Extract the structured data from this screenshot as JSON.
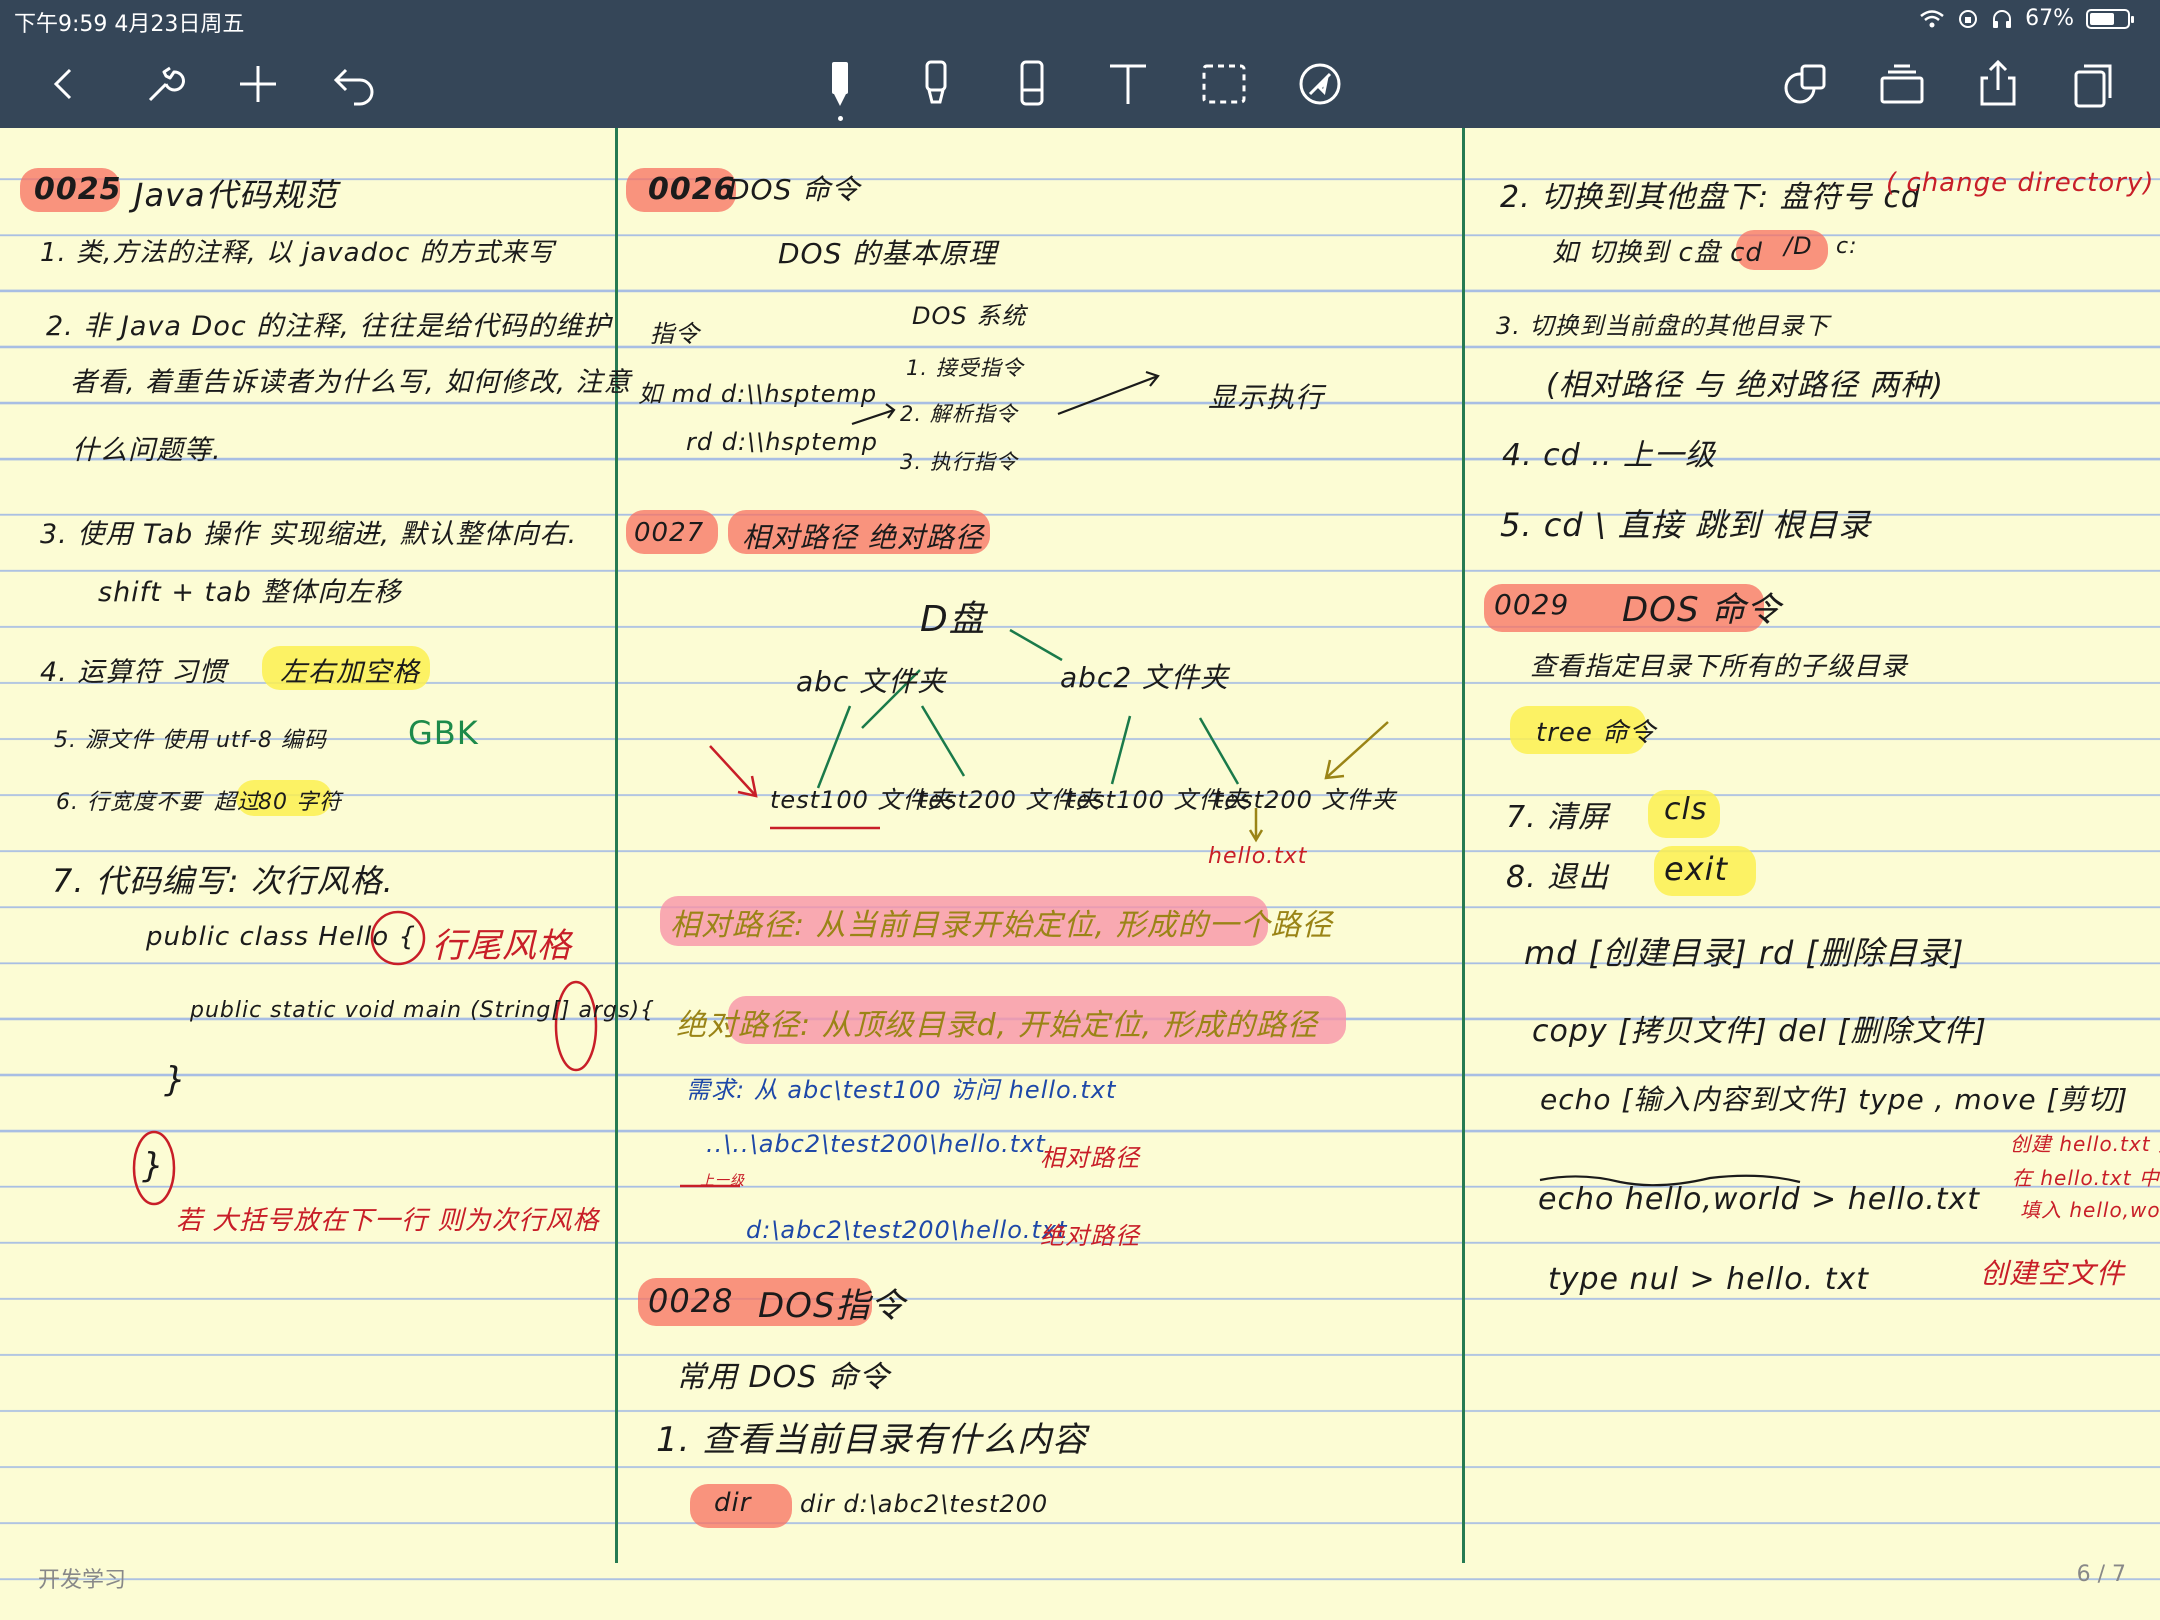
{
  "status": {
    "time": "下午9:59  4月23日周五",
    "battery_text": "67%",
    "battery_level": 0.67
  },
  "toolbar": {
    "left_tools": [
      "back-icon",
      "wrench-icon",
      "plus-icon",
      "undo-icon"
    ],
    "center_tools": [
      "pen-icon",
      "highlighter-icon",
      "eraser-icon",
      "text-icon",
      "lasso-icon",
      "sticker-icon"
    ],
    "right_tools": [
      "copy-page-icon",
      "pages-icon",
      "share-icon",
      "duplicate-icon"
    ],
    "active_tool": "pen-icon"
  },
  "col1": {
    "h0025": "0025",
    "h0025_title": "Java代码规范",
    "l1": "1. 类,方法的注释, 以 javadoc 的方式来写",
    "l2a": "2. 非 Java Doc 的注释, 往往是给代码的维护",
    "l2b": "者看, 着重告诉读者为什么写, 如何修改, 注意",
    "l2c": "什么问题等.",
    "l3a": "3. 使用 Tab 操作 实现缩进, 默认整体向右.",
    "l3b": "shift + tab  整体向左移",
    "l4a": "4.   运算符 习惯",
    "l4b": "左右加空格",
    "l5a": "5.   源文件 使用 utf-8 编码",
    "l5b": "GBK",
    "l6a": "6.   行宽度不要",
    "l6b": "超过",
    "l6c": "80 字符",
    "l7": "7. 代码编写: 次行风格.",
    "c1": "public  class  Hello {",
    "c1_note": "行尾风格",
    "c2": "public static void main (String[] args){",
    "c3": "}",
    "c4": "}",
    "note": "若 大括号放在下一行 则为次行风格"
  },
  "col2": {
    "h0026": "0026",
    "h0026_title": "DOS 命令",
    "sub": "DOS 的基本原理",
    "cmd_label": "指令",
    "sys_label": "DOS 系统",
    "cmd1": "如  md  d:\\\\hsptemp",
    "cmd2": "rd  d:\\\\hsptemp",
    "step1": "1. 接受指令",
    "step2": "2. 解析指令",
    "step3": "3. 执行指令",
    "result": "显示执行",
    "h0027": "0027",
    "h0027_title": "相对路径  绝对路径",
    "root": "D盘",
    "abc": "abc 文件夹",
    "abc2": "abc2 文件夹",
    "leaf1": "test100 文件夹",
    "leaf2": "test200 文件夹",
    "leaf3": "test100 文件夹",
    "leaf4": "test200 文件夹",
    "hello": "hello.txt",
    "rel_def": "相对路径: 从当前目录开始定位, 形成的一个路径",
    "abs_def": "绝对路径: 从顶级目录d, 开始定位, 形成的路径",
    "need": "需求: 从 abc\\test100 访问 hello.txt",
    "rel_ex": "..\\..\\abc2\\test200\\hello.txt",
    "rel_ex_note": "上一级",
    "rel_tag": "相对路径",
    "abs_ex": "d:\\abc2\\test200\\hello.txt",
    "abs_tag": "绝对路径",
    "h0028": "0028",
    "h0028_title": "DOS指令",
    "common": "常用 DOS 命令",
    "q1": "1. 查看当前目录有什么内容",
    "dir": "dir",
    "dir_ex": "dir d:\\abc2\\test200"
  },
  "col3": {
    "l2": "2. 切换到其他盘下: 盘符号 cd",
    "l2_note": "( change  directory)",
    "l2b": "如 切换到 c盘  cd",
    "l2b_hl": "/D",
    "l2b_end": "c:",
    "l3": "3. 切换到当前盘的其他目录下",
    "l3b": "(相对路径 与 绝对路径 两种)",
    "l4": "4.      cd ..  上一级",
    "l5": "5.  cd  \\    直接 跳到 根目录",
    "h0029": "0029",
    "h0029_title": "DOS 命令",
    "l6": "查看指定目录下所有的子级目录",
    "tree": "tree 命令",
    "l7": "7.   清屏",
    "cls": "cls",
    "l8": "8. 退出",
    "exit": "exit",
    "md": "md [创建目录]   rd [删除目录]",
    "copy": "copy [拷贝文件]   del [删除文件]",
    "echo": "echo [输入内容到文件]   type , move [剪切]",
    "echo_ex": "echo   hello,world   >   hello.txt",
    "echo_note1": "创建 hello.txt 并",
    "echo_note2": "在 hello.txt 中",
    "echo_note3": "填入 hello,world",
    "type_ex": "type    nul      >     hello. txt",
    "type_note": "创建空文件"
  },
  "footer": {
    "notebook": "开发学习",
    "page": "6 / 7"
  }
}
